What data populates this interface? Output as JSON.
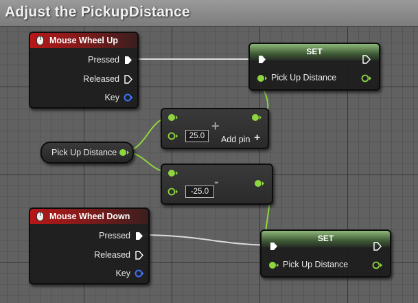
{
  "title": "Adjust the PickupDistance",
  "nodes": {
    "wheel_up": {
      "title": "Mouse Wheel Up",
      "pins": {
        "pressed": "Pressed",
        "released": "Released",
        "key": "Key"
      }
    },
    "wheel_down": {
      "title": "Mouse Wheel Down",
      "pins": {
        "pressed": "Pressed",
        "released": "Released",
        "key": "Key"
      }
    },
    "var_get": {
      "label": "Pick Up Distance"
    },
    "add": {
      "value": "25.0",
      "operator": "+",
      "add_pin_label": "Add pin",
      "add_pin_icon": "+"
    },
    "subtract": {
      "value": "-25.0",
      "operator": "-"
    },
    "set_top": {
      "title": "SET",
      "pin_label": "Pick Up Distance"
    },
    "set_bottom": {
      "title": "SET",
      "pin_label": "Pick Up Distance"
    }
  },
  "colors": {
    "float_pin": "#8dd63f",
    "exec_pin": "#ffffff",
    "key_pin": "#3d72ff",
    "event_header": "#b81818",
    "set_header": "#8fb87a"
  }
}
